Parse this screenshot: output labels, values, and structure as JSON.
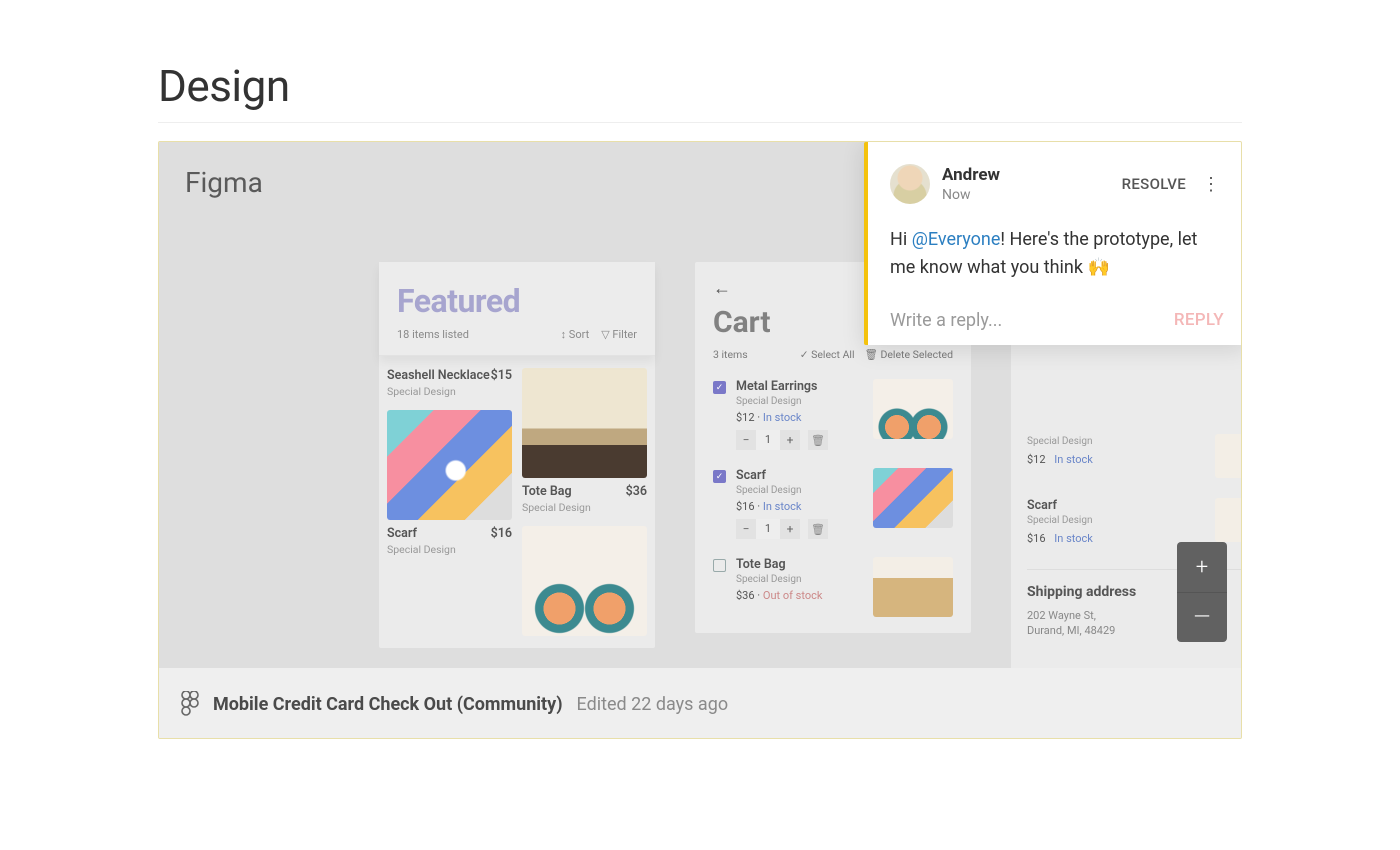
{
  "page": {
    "title": "Design"
  },
  "canvas": {
    "app_label": "Figma"
  },
  "featured": {
    "title": "Featured",
    "count_label": "18 items listed",
    "sort_label": "Sort",
    "filter_label": "Filter",
    "items": {
      "seashell": {
        "name": "Seashell Necklace",
        "price": "$15",
        "sub": "Special Design"
      },
      "tote": {
        "name": "Tote Bag",
        "price": "$36",
        "sub": "Special Design"
      },
      "scarf": {
        "name": "Scarf",
        "price": "$16",
        "sub": "Special Design"
      },
      "earrings": {
        "name": "",
        "price": "",
        "sub": ""
      }
    }
  },
  "cart": {
    "back_glyph": "←",
    "title": "Cart",
    "count_label": "3 items",
    "select_all": "Select All",
    "delete_selected": "Delete Selected",
    "items": [
      {
        "name": "Metal Earrings",
        "sub": "Special Design",
        "price": "$12",
        "stock": "In stock",
        "checked": true,
        "qty": "1",
        "thumb": "ear"
      },
      {
        "name": "Scarf",
        "sub": "Special Design",
        "price": "$16",
        "stock": "In stock",
        "checked": true,
        "qty": "1",
        "thumb": "scarf"
      },
      {
        "name": "Tote Bag",
        "sub": "Special Design",
        "price": "$36",
        "stock": "Out of stock",
        "checked": false,
        "qty": "",
        "thumb": "tote"
      }
    ]
  },
  "order": {
    "products": [
      {
        "name": "",
        "sub": "Special Design",
        "price": "$12",
        "stock": "In stock",
        "thumb": "ear"
      },
      {
        "name": "Scarf",
        "sub": "Special Design",
        "price": "$16",
        "stock": "In stock",
        "thumb": "scarf"
      }
    ],
    "shipping_title": "Shipping address",
    "address_line1": "202 Wayne St,",
    "address_line2": "Durand, MI, 48429"
  },
  "comment": {
    "author": "Andrew",
    "time": "Now",
    "resolve_label": "RESOLVE",
    "body_prefix": "Hi ",
    "mention": "@Everyone",
    "body_suffix": "! Here's the prototype, let me know what you think 🙌",
    "reply_placeholder": "Write a reply...",
    "reply_button": "REPLY"
  },
  "zoom": {
    "in": "+",
    "out": "—"
  },
  "footer": {
    "file_name": "Mobile Credit Card Check Out (Community)",
    "edited_label": "Edited 22 days ago"
  }
}
